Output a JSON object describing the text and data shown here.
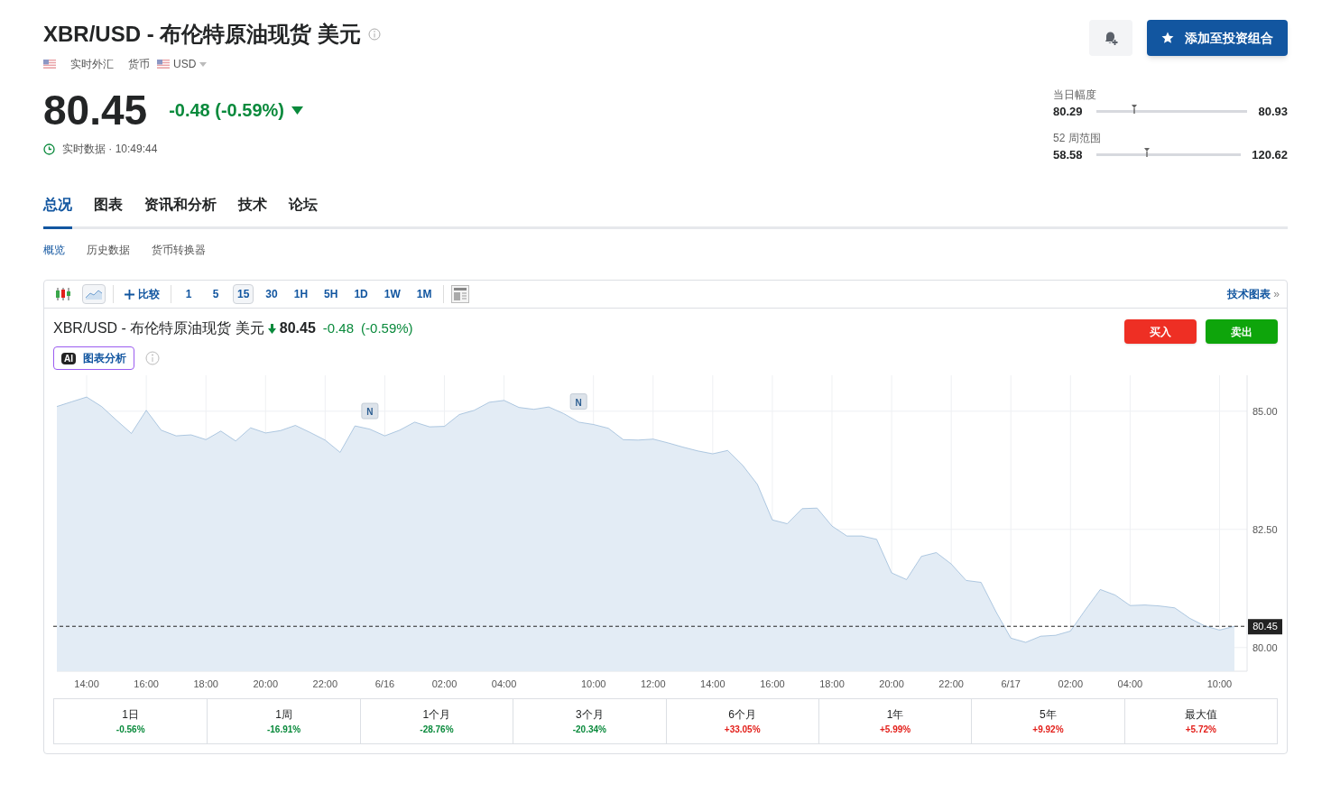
{
  "header": {
    "title": "XBR/USD - 布伦特原油现货 美元",
    "market": "实时外汇",
    "category": "货币",
    "currency": "USD",
    "price": "80.45",
    "change": "-0.48 (-0.59%)",
    "down": true,
    "status": "实时数据 · 10:49:44",
    "portfolio_button": "添加至投资组合"
  },
  "ranges": [
    {
      "label": "当日幅度",
      "low": "80.29",
      "high": "80.93",
      "level": 0.25
    },
    {
      "label": "52 周范围",
      "low": "58.58",
      "high": "120.62",
      "level": 0.35
    }
  ],
  "tabs": [
    {
      "label": "总况",
      "selected": true
    },
    {
      "label": "图表",
      "selected": false
    },
    {
      "label": "资讯和分析",
      "selected": false
    },
    {
      "label": "技术",
      "selected": false
    },
    {
      "label": "论坛",
      "selected": false
    }
  ],
  "subtabs": [
    {
      "label": "概览",
      "selected": true
    },
    {
      "label": "历史数据",
      "selected": false
    },
    {
      "label": "货币转换器",
      "selected": false
    }
  ],
  "toolbar": {
    "chart_types": [
      {
        "kind": "candles"
      },
      {
        "kind": "area"
      }
    ],
    "compare": "比较",
    "intervals": [
      {
        "label": "1",
        "selected": false
      },
      {
        "label": "5",
        "selected": false
      },
      {
        "label": "15",
        "selected": true
      },
      {
        "label": "30",
        "selected": false
      },
      {
        "label": "1H",
        "selected": false
      },
      {
        "label": "5H",
        "selected": false
      },
      {
        "label": "1D",
        "selected": false
      },
      {
        "label": "1W",
        "selected": false
      },
      {
        "label": "1M",
        "selected": false
      }
    ],
    "tech_link": "技术图表",
    "tech_link_arrow": "»"
  },
  "chart_header": {
    "title": "XBR/USD - 布伦特原油现货 美元",
    "price": "80.45",
    "change": "-0.48",
    "change_pct": "(-0.59%)",
    "down": true,
    "ai_badge": "AI",
    "ai_button": "图表分析",
    "buy": "买入",
    "sell": "卖出"
  },
  "chart": {
    "chart_data": {
      "type": "area",
      "categories": [
        null,
        null,
        "14:00",
        null,
        null,
        null,
        "16:00",
        null,
        null,
        null,
        "18:00",
        null,
        null,
        null,
        "20:00",
        null,
        null,
        null,
        "22:00",
        null,
        null,
        null,
        "6/16",
        null,
        null,
        null,
        "02:00",
        null,
        null,
        null,
        "04:00",
        null,
        null,
        null,
        null,
        null,
        "10:00",
        null,
        null,
        null,
        "12:00",
        null,
        null,
        null,
        "14:00",
        null,
        null,
        null,
        "16:00",
        null,
        null,
        null,
        "18:00",
        null,
        null,
        null,
        "20:00",
        null,
        null,
        null,
        "22:00",
        null,
        null,
        null,
        "6/17",
        null,
        null,
        null,
        "02:00",
        null,
        null,
        null,
        "04:00",
        null,
        null,
        null,
        null,
        null,
        "10:00",
        null
      ],
      "values": [
        85.1,
        85.2,
        85.3,
        85.1,
        84.81,
        84.53,
        85.02,
        84.6,
        84.48,
        84.5,
        84.4,
        84.58,
        84.37,
        84.65,
        84.54,
        84.59,
        84.7,
        84.55,
        84.39,
        84.13,
        84.69,
        84.62,
        84.48,
        84.6,
        84.77,
        84.67,
        84.68,
        84.93,
        85.02,
        85.19,
        85.23,
        85.08,
        85.04,
        85.09,
        84.95,
        84.77,
        84.72,
        84.64,
        84.4,
        84.39,
        84.41,
        84.33,
        84.24,
        84.16,
        84.1,
        84.17,
        83.86,
        83.45,
        82.7,
        82.62,
        82.94,
        82.95,
        82.57,
        82.36,
        82.36,
        82.29,
        81.58,
        81.44,
        81.93,
        82.01,
        81.77,
        81.42,
        81.38,
        80.76,
        80.2,
        80.11,
        80.24,
        80.26,
        80.35,
        80.8,
        81.23,
        81.11,
        80.89,
        80.9,
        80.88,
        80.84,
        80.62,
        80.46,
        80.37,
        80.45
      ],
      "ylim": [
        79.5,
        85.76
      ],
      "yticks": [
        {
          "value": 80,
          "label": "80.00"
        },
        {
          "value": 82.5,
          "label": "82.50"
        },
        {
          "value": 85,
          "label": "85.00"
        }
      ],
      "grid": true,
      "ref_lines": [
        {
          "axis": "y",
          "value": 80.45,
          "label": "80.45"
        }
      ],
      "annotations": [
        "N",
        "N"
      ]
    }
  },
  "periods": [
    {
      "label": "1日",
      "change": "-0.56%",
      "color": "#0a8a3c"
    },
    {
      "label": "1周",
      "change": "-16.91%",
      "color": "#0a8a3c"
    },
    {
      "label": "1个月",
      "change": "-28.76%",
      "color": "#0a8a3c"
    },
    {
      "label": "3个月",
      "change": "-20.34%",
      "color": "#0a8a3c"
    },
    {
      "label": "6个月",
      "change": "+33.05%",
      "color": "#e3201b"
    },
    {
      "label": "1年",
      "change": "+5.99%",
      "color": "#e3201b"
    },
    {
      "label": "5年",
      "change": "+9.92%",
      "color": "#e3201b"
    },
    {
      "label": "最大值",
      "change": "+5.72%",
      "color": "#e3201b"
    }
  ]
}
